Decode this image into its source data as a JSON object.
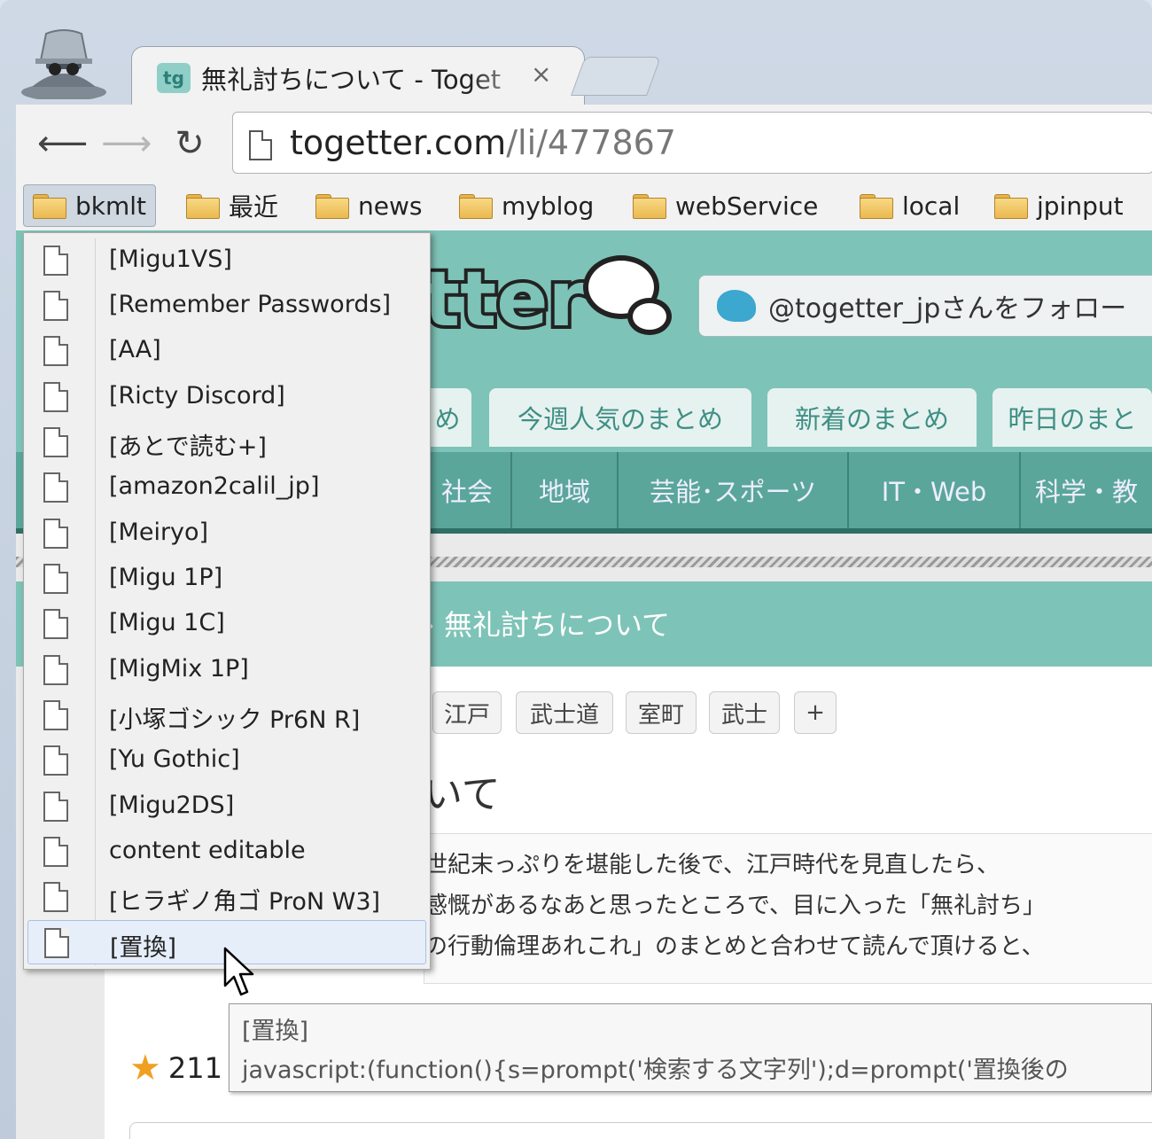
{
  "browser": {
    "tab_title": "無礼討ちについて - Toget",
    "tab_close": "×",
    "favicon_text": "tg",
    "url_domain": "togetter.com",
    "url_path": "/li/477867"
  },
  "bookmarks_bar": [
    {
      "label": "bkmlt"
    },
    {
      "label": "最近"
    },
    {
      "label": "news"
    },
    {
      "label": "myblog"
    },
    {
      "label": "webService"
    },
    {
      "label": "local"
    },
    {
      "label": "jpinput"
    }
  ],
  "bookmark_menu": [
    {
      "label": "[Migu1VS]"
    },
    {
      "label": "[Remember Passwords]"
    },
    {
      "label": "[AA]"
    },
    {
      "label": "[Ricty Discord]"
    },
    {
      "label": "[あとで読む+]"
    },
    {
      "label": "[amazon2calil_jp]"
    },
    {
      "label": "[Meiryo]"
    },
    {
      "label": "[Migu 1P]"
    },
    {
      "label": "[Migu 1C]"
    },
    {
      "label": "[MigMix 1P]"
    },
    {
      "label": "[小塚ゴシック Pr6N R]"
    },
    {
      "label": "[Yu Gothic]"
    },
    {
      "label": "[Migu2DS]"
    },
    {
      "label": "content editable"
    },
    {
      "label": "[ヒラギノ角ゴ ProN W3]"
    },
    {
      "label": "[置換]"
    }
  ],
  "tooltip": {
    "title": "[置換]",
    "url": "javascript:(function(){s=prompt('検索する文字列');d=prompt('置換後の"
  },
  "page": {
    "logo_text": "tter",
    "follow_button": "@togetter_jpさんをフォロー",
    "subtabs": [
      "め",
      "今週人気のまとめ",
      "新着のまとめ",
      "昨日のまと"
    ],
    "categories": [
      "社会",
      "地域",
      "芸能･スポーツ",
      "IT・Web",
      "科学・教"
    ],
    "title_band": "› 無礼討ちについて",
    "tags": [
      "江戸",
      "武士道",
      "室町",
      "武士",
      "+"
    ],
    "big_title": "いて",
    "description_lines": [
      "世紀末っぷりを堪能した後で、江戸時代を見直したら、",
      "感慨があるなあと思ったところで、目に入った「無礼討ち」",
      "の行動倫理あれこれ」のまとめと合わせて読んで頂けると、"
    ],
    "star_count": "211"
  },
  "colors": {
    "header_teal": "#7ec3b7",
    "category_teal": "#5aa69a",
    "menu_bg": "#f0f0f0",
    "highlight": "#e6eef9"
  }
}
